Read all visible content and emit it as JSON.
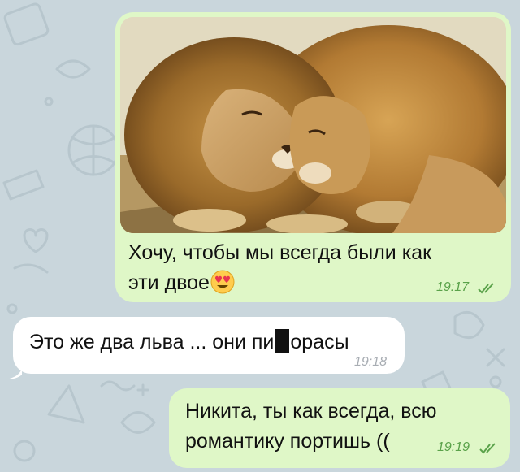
{
  "chat": {
    "messages": [
      {
        "direction": "outgoing",
        "has_photo": true,
        "photo_description_icon": "two-lions-photo",
        "text": "Хочу, чтобы мы всегда были как эти двое",
        "emoji": "heart-eyes-emoji",
        "time": "19:17",
        "status_icon": "double-check-icon"
      },
      {
        "direction": "incoming",
        "text_before": "Это же два льва ... они пи",
        "text_after": "орасы",
        "time": "19:18"
      },
      {
        "direction": "outgoing",
        "text": "Никита, ты как всегда, всю романтику портишь ((",
        "time": "19:19",
        "status_icon": "double-check-icon"
      }
    ]
  },
  "colors": {
    "background": "#c9d6dc",
    "outgoing_bubble": "#dff7c7",
    "incoming_bubble": "#ffffff",
    "outgoing_time": "#5aa24a",
    "incoming_time": "#a8adb3"
  }
}
